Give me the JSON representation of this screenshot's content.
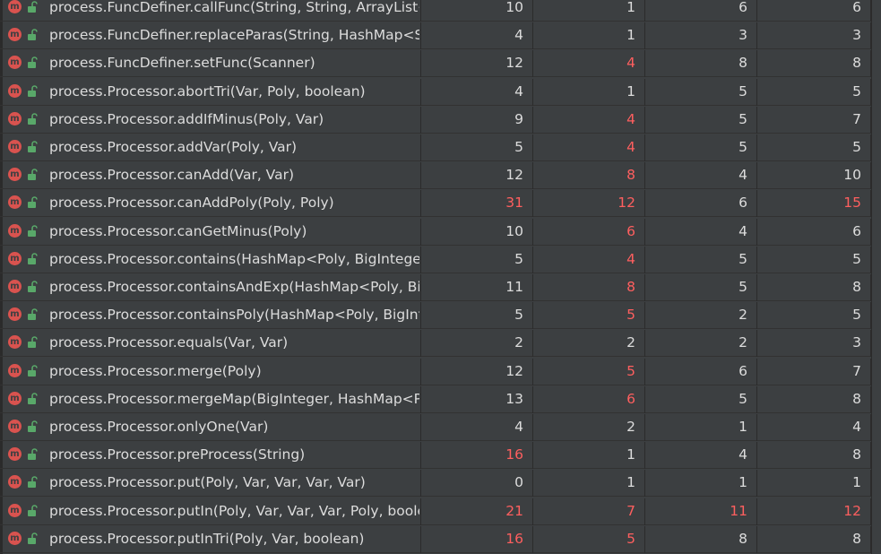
{
  "rows": [
    {
      "method": "process.FuncDefiner.callFunc(String, String, ArrayList<String>)",
      "v1": "10",
      "v2": "1",
      "v3": "6",
      "v4": "6",
      "hot": [
        false,
        false,
        false,
        false
      ]
    },
    {
      "method": "process.FuncDefiner.replaceParas(String, HashMap<String, String>)",
      "v1": "4",
      "v2": "1",
      "v3": "3",
      "v4": "3",
      "hot": [
        false,
        false,
        false,
        false
      ]
    },
    {
      "method": "process.FuncDefiner.setFunc(Scanner)",
      "v1": "12",
      "v2": "4",
      "v3": "8",
      "v4": "8",
      "hot": [
        false,
        true,
        false,
        false
      ]
    },
    {
      "method": "process.Processor.abortTri(Var, Poly, boolean)",
      "v1": "4",
      "v2": "1",
      "v3": "5",
      "v4": "5",
      "hot": [
        false,
        false,
        false,
        false
      ]
    },
    {
      "method": "process.Processor.addIfMinus(Poly, Var)",
      "v1": "9",
      "v2": "4",
      "v3": "5",
      "v4": "7",
      "hot": [
        false,
        true,
        false,
        false
      ]
    },
    {
      "method": "process.Processor.addVar(Poly, Var)",
      "v1": "5",
      "v2": "4",
      "v3": "5",
      "v4": "5",
      "hot": [
        false,
        true,
        false,
        false
      ]
    },
    {
      "method": "process.Processor.canAdd(Var, Var)",
      "v1": "12",
      "v2": "8",
      "v3": "4",
      "v4": "10",
      "hot": [
        false,
        true,
        false,
        false
      ]
    },
    {
      "method": "process.Processor.canAddPoly(Poly, Poly)",
      "v1": "31",
      "v2": "12",
      "v3": "6",
      "v4": "15",
      "hot": [
        true,
        true,
        false,
        true
      ]
    },
    {
      "method": "process.Processor.canGetMinus(Poly)",
      "v1": "10",
      "v2": "6",
      "v3": "4",
      "v4": "6",
      "hot": [
        false,
        true,
        false,
        false
      ]
    },
    {
      "method": "process.Processor.contains(HashMap<Poly, BigInteger>, Poly)",
      "v1": "5",
      "v2": "4",
      "v3": "5",
      "v4": "5",
      "hot": [
        false,
        true,
        false,
        false
      ]
    },
    {
      "method": "process.Processor.containsAndExp(HashMap<Poly, BigInteger>, Poly)",
      "v1": "11",
      "v2": "8",
      "v3": "5",
      "v4": "8",
      "hot": [
        false,
        true,
        false,
        false
      ]
    },
    {
      "method": "process.Processor.containsPoly(HashMap<Poly, BigInteger>, Poly)",
      "v1": "5",
      "v2": "5",
      "v3": "2",
      "v4": "5",
      "hot": [
        false,
        true,
        false,
        false
      ]
    },
    {
      "method": "process.Processor.equals(Var, Var)",
      "v1": "2",
      "v2": "2",
      "v3": "2",
      "v4": "3",
      "hot": [
        false,
        false,
        false,
        false
      ]
    },
    {
      "method": "process.Processor.merge(Poly)",
      "v1": "12",
      "v2": "5",
      "v3": "6",
      "v4": "7",
      "hot": [
        false,
        true,
        false,
        false
      ]
    },
    {
      "method": "process.Processor.mergeMap(BigInteger, HashMap<Poly, BigInteger>)",
      "v1": "13",
      "v2": "6",
      "v3": "5",
      "v4": "8",
      "hot": [
        false,
        true,
        false,
        false
      ]
    },
    {
      "method": "process.Processor.onlyOne(Var)",
      "v1": "4",
      "v2": "2",
      "v3": "1",
      "v4": "4",
      "hot": [
        false,
        false,
        false,
        false
      ]
    },
    {
      "method": "process.Processor.preProcess(String)",
      "v1": "16",
      "v2": "1",
      "v3": "4",
      "v4": "8",
      "hot": [
        true,
        false,
        false,
        false
      ]
    },
    {
      "method": "process.Processor.put(Poly, Var, Var, Var, Var)",
      "v1": "0",
      "v2": "1",
      "v3": "1",
      "v4": "1",
      "hot": [
        false,
        false,
        false,
        false
      ]
    },
    {
      "method": "process.Processor.putIn(Poly, Var, Var, Var, Poly, boolean)",
      "v1": "21",
      "v2": "7",
      "v3": "11",
      "v4": "12",
      "hot": [
        true,
        true,
        true,
        true
      ]
    },
    {
      "method": "process.Processor.putInTri(Poly, Var, boolean)",
      "v1": "16",
      "v2": "5",
      "v3": "8",
      "v4": "8",
      "hot": [
        true,
        true,
        false,
        false
      ]
    }
  ],
  "icons": {
    "method_icon": "method-m-icon",
    "method_icon_glyph": "m",
    "visibility_icon": "public-lock-icon"
  },
  "colors": {
    "background": "#3c3f41",
    "text": "#dcdcdc",
    "hot_value": "#ff5f5f",
    "method_icon": "#d9534f",
    "public_icon": "#59a869"
  }
}
